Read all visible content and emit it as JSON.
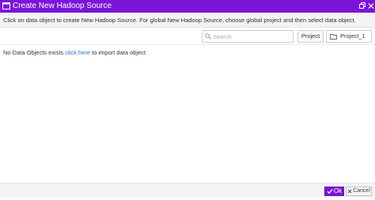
{
  "dialog": {
    "title": "Create New Hadoop Source"
  },
  "instruction": {
    "text": "Click on data object to create New Hadoop Source. For global New Hadoop Source, choose global project and then select data object."
  },
  "toolbar": {
    "search_placeholder": "Search",
    "project_button_label": "Project",
    "project_selected": "Project_1"
  },
  "content": {
    "empty_prefix": "No Data Objects exists ",
    "empty_link": "click here",
    "empty_suffix": " to import data object"
  },
  "footer": {
    "ok_label": "Ok",
    "cancel_label": "Cancel"
  },
  "colors": {
    "accent": "#7b14d9",
    "link": "#1a73c9"
  },
  "icons": {
    "title": "window-icon",
    "maximize": "maximize-icon",
    "close": "close-icon",
    "search": "search-icon",
    "folder": "folder-icon",
    "ok": "check-icon",
    "cancel": "x-icon"
  }
}
